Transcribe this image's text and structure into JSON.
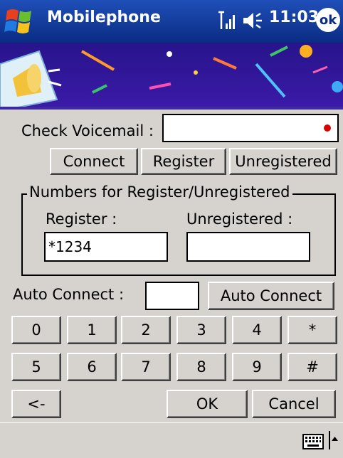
{
  "titlebar": {
    "app_title": "Mobilephone",
    "clock": "11:03",
    "ok_label": "ok"
  },
  "form": {
    "check_voicemail_label": "Check Voicemail :",
    "check_voicemail_value": "",
    "buttons": {
      "connect": "Connect",
      "register": "Register",
      "unregistered": "Unregistered"
    },
    "group_label": "Numbers for Register/Unregistered",
    "register_label": "Register :",
    "register_value": "*1234",
    "unregistered_label": "Unregistered :",
    "unregistered_value": "",
    "auto_connect_label": "Auto Connect :",
    "auto_connect_value": "",
    "auto_connect_button": "Auto Connect"
  },
  "keypad": [
    "0",
    "1",
    "2",
    "3",
    "4",
    "*",
    "5",
    "6",
    "7",
    "8",
    "9",
    "#"
  ],
  "actions": {
    "back": "<-",
    "ok": "OK",
    "cancel": "Cancel"
  },
  "icons": [
    "windows-start-icon",
    "signal-icon",
    "volume-icon",
    "keyboard-icon",
    "sip-arrow-icon",
    "megaphone-icon"
  ],
  "colors": {
    "titlebar": "#0a2c83",
    "banner": "#2d178f",
    "background": "#d6d3ce"
  }
}
